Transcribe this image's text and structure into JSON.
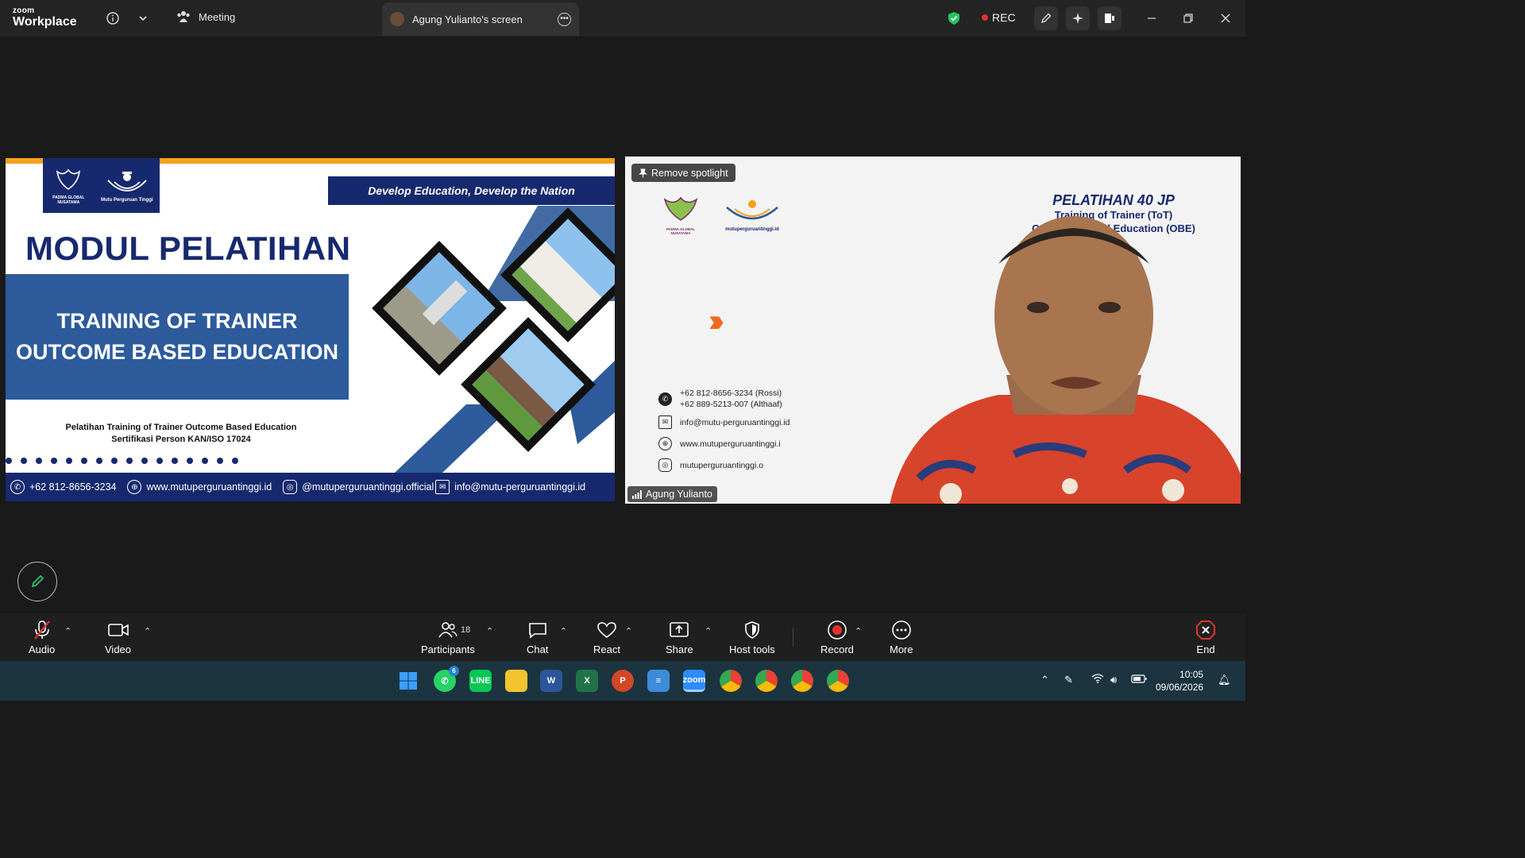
{
  "titlebar": {
    "logo_line1": "zoom",
    "logo_line2": "Workplace",
    "meeting_label": "Meeting",
    "screen_tab_label": "Agung  Yulianto's screen",
    "rec_label": "REC"
  },
  "slide": {
    "motto": "Develop Education, Develop the Nation",
    "logo_left": "PADMA GLOBAL NUSATAMA",
    "logo_right": "Mutu Perguruan Tinggi",
    "title": "MODUL PELATIHAN",
    "box_line1": "TRAINING OF TRAINER",
    "box_line2": "OUTCOME BASED EDUCATION",
    "subtitle_line1": "Pelatihan Training of Trainer Outcome Based Education",
    "subtitle_line2": "Sertifikasi Person KAN/ISO 17024",
    "footer": {
      "phone": "+62 812-8656-3234",
      "web": "www.mutuperguruantinggi.id",
      "instagram": "@mutuperguruantinggi.official",
      "email": "info@mutu-perguruantinggi.id"
    }
  },
  "video": {
    "spotlight_label": "Remove spotlight",
    "heading1": "PELATIHAN 40 JP",
    "heading2": "Training of Trainer (ToT)",
    "heading3": "Outcome Based Education (OBE)",
    "logo_left": "PADMA GLOBAL NUSATAMA",
    "logo_right": "mutuperguruantinggi.id",
    "contact_phone1": "+62 812-8656-3234 (Rossi)",
    "contact_phone2": "+62 889-5213-007 (Althaaf)",
    "contact_email": "info@mutu-perguruantinggi.id",
    "contact_web": "www.mutuperguruantinggi.i",
    "contact_ig": "mutuperguruantinggi.o",
    "name_tag": "Agung  Yulianto"
  },
  "toolbar": {
    "audio": "Audio",
    "video": "Video",
    "participants": "Participants",
    "participant_count": "18",
    "chat": "Chat",
    "react": "React",
    "share": "Share",
    "host_tools": "Host tools",
    "record": "Record",
    "more": "More",
    "end": "End"
  },
  "taskbar": {
    "whatsapp_badge": "6",
    "time": "10:05",
    "date": "09/06/2026"
  },
  "colors": {
    "navy": "#17296e",
    "blue_box": "#2d5b9b",
    "orange": "#f4a11b",
    "record_red": "#e0332f",
    "end_red": "#e0332f",
    "pen_green": "#2fd07a"
  }
}
